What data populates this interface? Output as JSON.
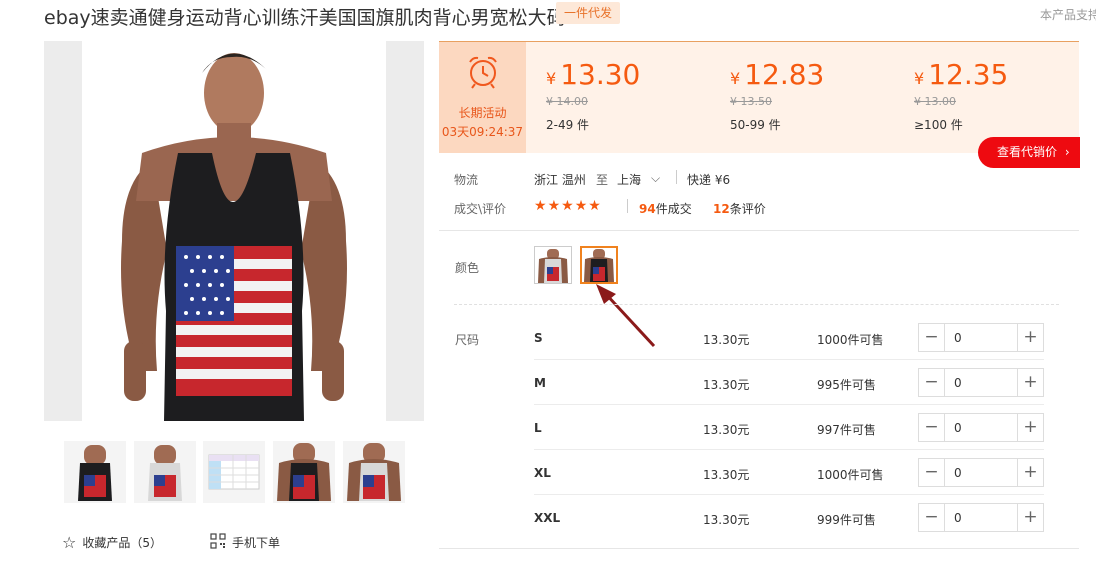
{
  "header": {
    "title": "ebay速卖通健身运动背心训练汗美国国旗肌肉背心男宽松大码",
    "badge": "一件代发",
    "support": "本产品支持"
  },
  "gallery": {
    "thumb_count": 5
  },
  "actions": {
    "favorite": "收藏产品（5）",
    "mobile": "手机下单"
  },
  "promo": {
    "label": "长期活动",
    "countdown": "03天09:24:37"
  },
  "price_tiers": [
    {
      "currency": "¥",
      "price": "13.30",
      "original": "¥ 14.00",
      "range": "2-49 件"
    },
    {
      "currency": "¥",
      "price": "12.83",
      "original": "¥ 13.50",
      "range": "50-99 件"
    },
    {
      "currency": "¥",
      "price": "12.35",
      "original": "¥ 13.00",
      "range": "≥100 件"
    }
  ],
  "agent_button": "查看代销价",
  "logistics": {
    "label": "物流",
    "from": "浙江 温州",
    "to_word": "至",
    "to": "上海",
    "shipping": "快递 ¥6"
  },
  "deals": {
    "label": "成交\\评价",
    "rating": 4.5,
    "deals_count": "94",
    "deals_suffix": "件成交",
    "reviews_count": "12",
    "reviews_suffix": "条评价"
  },
  "color": {
    "label": "颜色",
    "selected_index": 1
  },
  "size": {
    "label": "尺码",
    "rows": [
      {
        "size": "S",
        "price": "13.30元",
        "stock": "1000件可售",
        "qty": "0"
      },
      {
        "size": "M",
        "price": "13.30元",
        "stock": "995件可售",
        "qty": "0"
      },
      {
        "size": "L",
        "price": "13.30元",
        "stock": "997件可售",
        "qty": "0"
      },
      {
        "size": "XL",
        "price": "13.30元",
        "stock": "1000件可售",
        "qty": "0"
      },
      {
        "size": "XXL",
        "price": "13.30元",
        "stock": "999件可售",
        "qty": "0"
      }
    ]
  },
  "colors": {
    "accent": "#f55a10",
    "promo_bg": "#fcd8c0",
    "price_bg": "#fff2e8",
    "button_red": "#ee0a10",
    "arrow": "#8b1a1a"
  }
}
